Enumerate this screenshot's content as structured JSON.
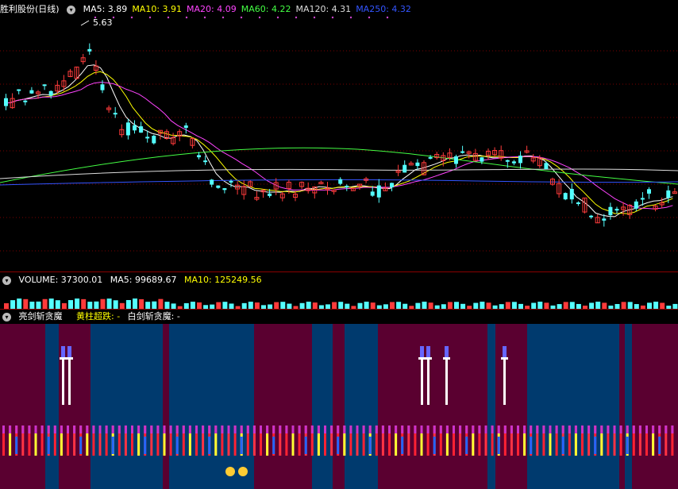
{
  "main": {
    "stock_name": "胜利股份(日线)",
    "legend": [
      {
        "label": "MA5: 3.89",
        "color": "#ffffff"
      },
      {
        "label": "MA10: 3.91",
        "color": "#ffff00"
      },
      {
        "label": "MA20: 4.09",
        "color": "#ff44ff"
      },
      {
        "label": "MA60: 4.22",
        "color": "#44ff44"
      },
      {
        "label": "MA120: 4.31",
        "color": "#dddddd"
      },
      {
        "label": "MA250: 4.32",
        "color": "#3355ff"
      }
    ],
    "high_marker": "5.63"
  },
  "volume": {
    "label": "VOLUME: 37300.01",
    "ma5": "MA5: 99689.67",
    "ma10": "MA10: 125249.56",
    "colors": {
      "label": "#ffffff",
      "ma5": "#ffffff",
      "ma10": "#ffff00"
    }
  },
  "indicator": {
    "name": "亮剑斩贪魔",
    "yellow": "黄柱超跌: -",
    "white": "白剑斩贪魔: -",
    "colors": {
      "name": "#ffffff",
      "yellow": "#ffff00",
      "white": "#ffffff"
    }
  },
  "colors": {
    "up": "#ff3b3b",
    "down": "#54ffff",
    "grid": "#7a0000",
    "bg_maroon": "#5a0030",
    "bg_blue": "#003a6e"
  }
}
